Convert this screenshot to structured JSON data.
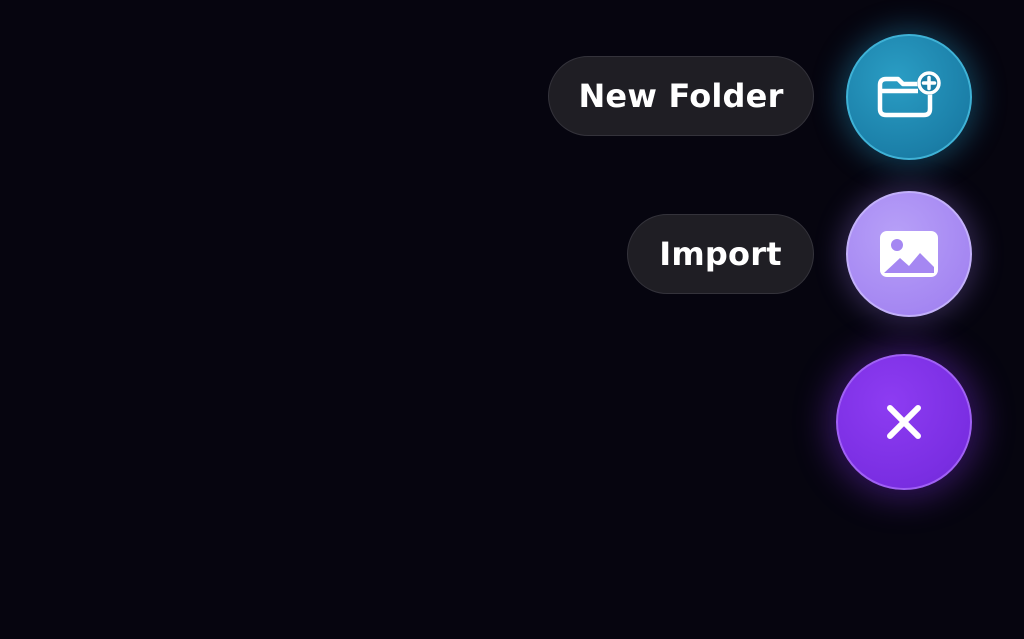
{
  "fab_menu": {
    "actions": [
      {
        "label": "New Folder",
        "icon": "folder-plus-icon",
        "color": "#1b7fa8"
      },
      {
        "label": "Import",
        "icon": "image-icon",
        "color": "#a587f2"
      }
    ],
    "close_button": {
      "icon": "close-icon",
      "color": "#7a2ee2"
    }
  },
  "colors": {
    "background": "#06050f",
    "pill_background": "#1f1e24",
    "text": "#ffffff"
  }
}
